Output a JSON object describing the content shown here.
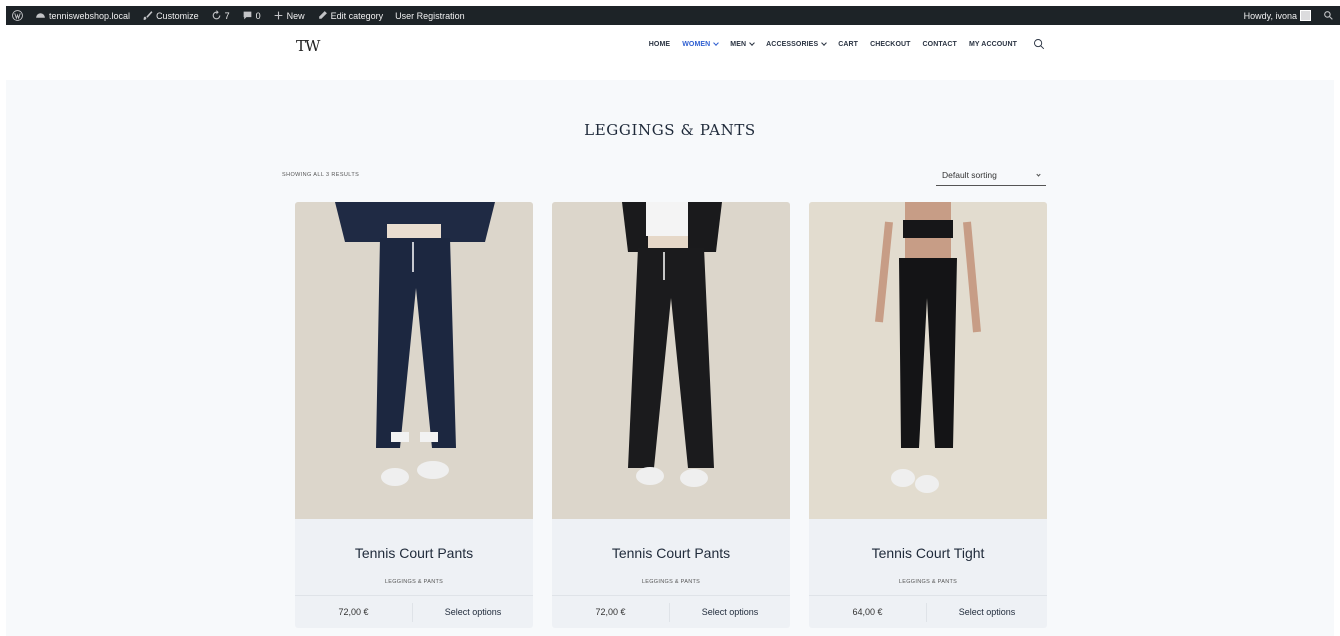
{
  "adminbar": {
    "site": "tenniswebshop.local",
    "customize": "Customize",
    "updates": "7",
    "comments": "0",
    "new": "New",
    "edit_category": "Edit category",
    "user_registration": "User Registration",
    "howdy": "Howdy, ivona"
  },
  "header": {
    "logo": "TW",
    "nav": [
      {
        "label": "HOME",
        "active": false,
        "dropdown": false
      },
      {
        "label": "WOMEN",
        "active": true,
        "dropdown": true
      },
      {
        "label": "MEN",
        "active": false,
        "dropdown": true
      },
      {
        "label": "ACCESSORIES",
        "active": false,
        "dropdown": true
      },
      {
        "label": "CART",
        "active": false,
        "dropdown": false
      },
      {
        "label": "CHECKOUT",
        "active": false,
        "dropdown": false
      },
      {
        "label": "CONTACT",
        "active": false,
        "dropdown": false
      },
      {
        "label": "MY ACCOUNT",
        "active": false,
        "dropdown": false
      }
    ]
  },
  "shop": {
    "title": "LEGGINGS & PANTS",
    "results": "SHOWING ALL 3 RESULTS",
    "sorting": "Default sorting"
  },
  "products": [
    {
      "name": "Tennis Court Pants",
      "category": "LEGGINGS & PANTS",
      "price": "72,00 €",
      "action": "Select options",
      "color": "#1c2740"
    },
    {
      "name": "Tennis Court Pants",
      "category": "LEGGINGS & PANTS",
      "price": "72,00 €",
      "action": "Select options",
      "color": "#1b1b1d"
    },
    {
      "name": "Tennis Court Tight",
      "category": "LEGGINGS & PANTS",
      "price": "64,00 €",
      "action": "Select options",
      "color": "#141416"
    }
  ],
  "colors": {
    "adminbar_bg": "#1d2327",
    "accent": "#2f5fd1",
    "content_bg": "#f7f9fb",
    "card_bg": "#eef1f5",
    "photo_bg": "#dcd6cb"
  }
}
